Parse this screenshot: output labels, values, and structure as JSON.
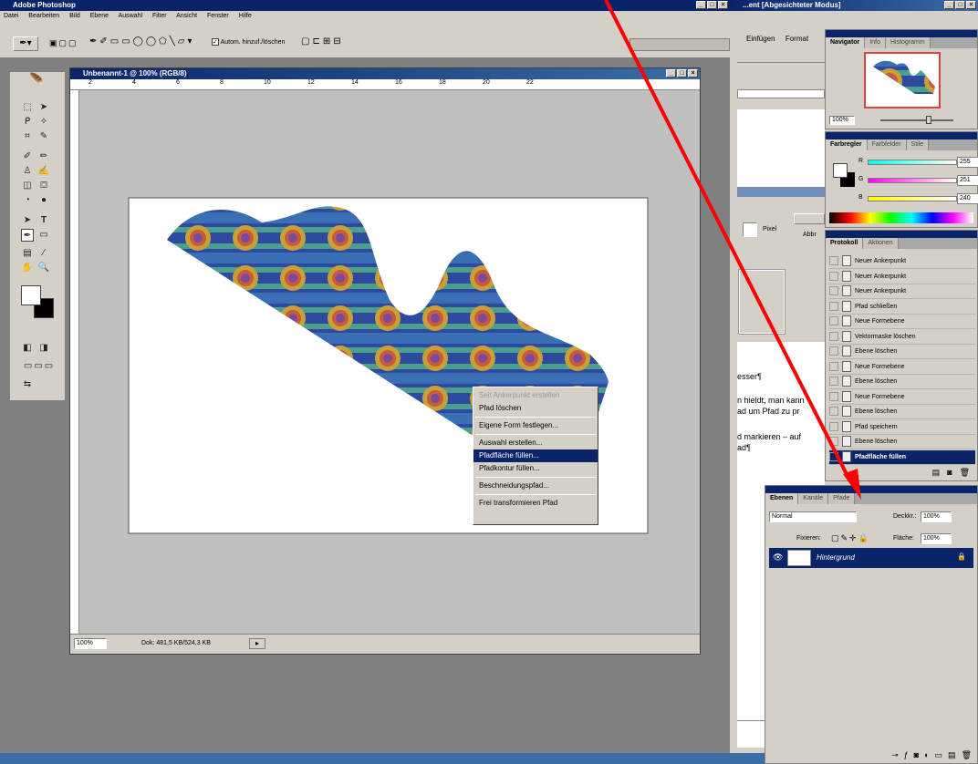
{
  "photoshop": {
    "title": "Adobe Photoshop",
    "menu": [
      "Datei",
      "Bearbeiten",
      "Bild",
      "Ebene",
      "Auswahl",
      "Filter",
      "Ansicht",
      "Fenster",
      "Hilfe"
    ],
    "options": {
      "auto_add_delete": "Autom. hinzuf./löschen"
    }
  },
  "document": {
    "title": "Unbenannt-1 @ 100% (RGB/8)",
    "ruler_labels": [
      "2",
      "4",
      "6",
      "8",
      "10",
      "12",
      "14",
      "16",
      "18",
      "20",
      "22"
    ],
    "status": {
      "zoom": "100%",
      "doc_info": "Dok: 481,5 KB/524,3 KB"
    }
  },
  "context_menu": {
    "items": [
      {
        "label": "Seit Ankerpunkt erstellen",
        "state": "disabled"
      },
      {
        "label": "Pfad löschen",
        "state": "normal"
      },
      {
        "sep": true
      },
      {
        "label": "Eigene Form festlegen...",
        "state": "normal"
      },
      {
        "sep": true
      },
      {
        "label": "Auswahl erstellen...",
        "state": "normal"
      },
      {
        "label": "Pfadfläche füllen...",
        "state": "selected"
      },
      {
        "label": "Pfadkontur füllen...",
        "state": "normal"
      },
      {
        "sep": true
      },
      {
        "label": "Beschneidungspfad...",
        "state": "normal"
      },
      {
        "sep": true
      },
      {
        "label": "Frei transformieren Pfad",
        "state": "normal"
      }
    ]
  },
  "word": {
    "title": "...ent [Abgesichteter Modus]",
    "menu": [
      "Einfügen",
      "Format"
    ],
    "pixel_label": "Pixel",
    "abbrechen": "Abbr",
    "text_lines": [
      "esser¶",
      "n hieldt, man kann",
      "ad um Pfad zu pr",
      "d markieren – auf",
      "ad¶"
    ]
  },
  "navigator": {
    "tabs": [
      "Navigator",
      "Info",
      "Histogramm"
    ],
    "zoom": "100%"
  },
  "color": {
    "tabs": [
      "Farbregler",
      "Farbfelder",
      "Stile"
    ],
    "channels": [
      {
        "label": "R",
        "value": "255",
        "pos": 0.97
      },
      {
        "label": "G",
        "value": "251",
        "pos": 0.95
      },
      {
        "label": "B",
        "value": "240",
        "pos": 0.92
      }
    ]
  },
  "history": {
    "tabs": [
      "Protokoll",
      "Aktionen"
    ],
    "items": [
      {
        "label": "Neuer Ankerpunkt",
        "selected": false
      },
      {
        "label": "Neuer Ankerpunkt",
        "selected": false
      },
      {
        "label": "Neuer Ankerpunkt",
        "selected": false
      },
      {
        "label": "Pfad schließen",
        "selected": false
      },
      {
        "label": "Neue Formebene",
        "selected": false
      },
      {
        "label": "Vektormaske löschen",
        "selected": false
      },
      {
        "label": "Ebene löschen",
        "selected": false
      },
      {
        "label": "Neue Formebene",
        "selected": false
      },
      {
        "label": "Ebene löschen",
        "selected": false
      },
      {
        "label": "Neue Formebene",
        "selected": false
      },
      {
        "label": "Ebene löschen",
        "selected": false
      },
      {
        "label": "Pfad speichern",
        "selected": false
      },
      {
        "label": "Ebene löschen",
        "selected": false
      },
      {
        "label": "Pfadfläche füllen",
        "selected": true
      }
    ]
  },
  "layers": {
    "tabs": [
      "Ebenen",
      "Kanäle",
      "Pfade"
    ],
    "mode": "Normal",
    "opacity_label": "Deckkr.:",
    "opacity": "100%",
    "fixieren_label": "Fixieren:",
    "fill_label": "Fläche:",
    "fill": "100%",
    "layer_name": "Hintergrund"
  },
  "colors": {
    "titlebar": "#0a246a",
    "selection": "#0a246a",
    "annotation_arrow": "#ff0000"
  }
}
